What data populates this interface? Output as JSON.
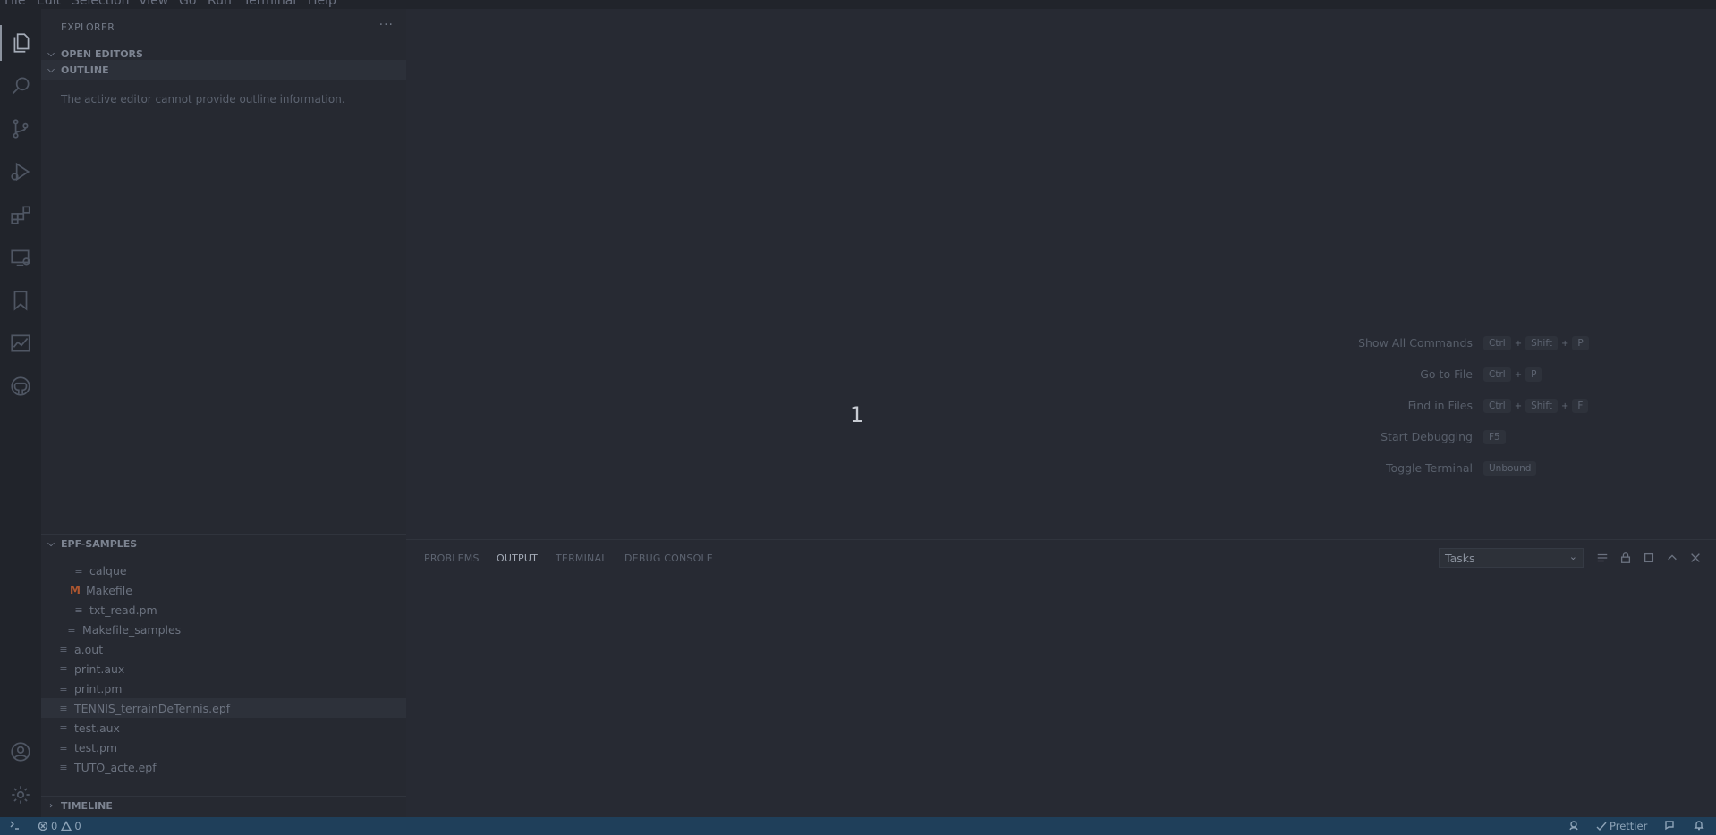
{
  "menu": [
    "File",
    "Edit",
    "Selection",
    "View",
    "Go",
    "Run",
    "Terminal",
    "Help"
  ],
  "activity_bar": {
    "top": [
      "explorer-icon",
      "search-icon",
      "source-control-icon",
      "run-debug-icon",
      "extensions-icon",
      "remote-explorer-icon",
      "bookmark-icon",
      "chart-icon",
      "github-icon"
    ],
    "bottom": [
      "account-icon",
      "settings-gear-icon"
    ]
  },
  "sidebar": {
    "title": "EXPLORER",
    "more": "···",
    "open_editors": "OPEN EDITORS",
    "outline": "OUTLINE",
    "outline_message": "The active editor cannot provide outline information.",
    "folder": "EPF-SAMPLES",
    "timeline": "TIMELINE",
    "files": [
      {
        "name": "calque",
        "icon": "file-lines-icon"
      },
      {
        "name": "Makefile",
        "icon": "makefile-icon"
      },
      {
        "name": "txt_read.pm",
        "icon": "file-lines-icon"
      },
      {
        "name": "Makefile_samples",
        "icon": "file-lines-icon"
      },
      {
        "name": "a.out",
        "icon": "file-lines-icon"
      },
      {
        "name": "print.aux",
        "icon": "file-lines-icon"
      },
      {
        "name": "print.pm",
        "icon": "file-lines-icon"
      },
      {
        "name": "TENNIS_terrainDeTennis.epf",
        "icon": "file-lines-icon"
      },
      {
        "name": "test.aux",
        "icon": "file-lines-icon"
      },
      {
        "name": "test.pm",
        "icon": "file-lines-icon"
      },
      {
        "name": "TUTO_acte.epf",
        "icon": "file-lines-icon"
      }
    ]
  },
  "editor": {
    "center_number": "1",
    "shortcuts": [
      {
        "label": "Show All Commands",
        "keys": [
          "Ctrl",
          "Shift",
          "P"
        ]
      },
      {
        "label": "Go to File",
        "keys": [
          "Ctrl",
          "P"
        ]
      },
      {
        "label": "Find in Files",
        "keys": [
          "Ctrl",
          "Shift",
          "F"
        ]
      },
      {
        "label": "Start Debugging",
        "keys": [
          "F5"
        ]
      },
      {
        "label": "Toggle Terminal",
        "keys": [
          "Unbound"
        ]
      }
    ],
    "plus_sign": "+"
  },
  "panel": {
    "tabs": [
      "PROBLEMS",
      "OUTPUT",
      "TERMINAL",
      "DEBUG CONSOLE"
    ],
    "active_tab": "OUTPUT",
    "select_value": "Tasks",
    "icons": [
      "clear-output-icon",
      "lock-icon",
      "maximize-panel-icon",
      "chevron-up-icon",
      "close-icon"
    ]
  },
  "status": {
    "errors": "0",
    "warnings": "0",
    "prettier": "Prettier"
  }
}
